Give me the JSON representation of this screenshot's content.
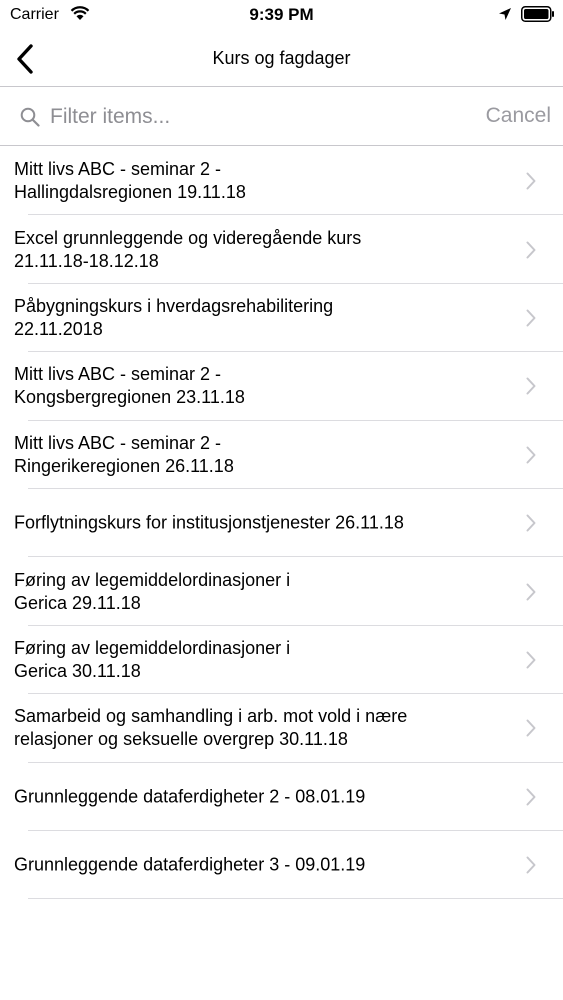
{
  "status_bar": {
    "carrier": "Carrier",
    "time": "9:39 PM"
  },
  "nav": {
    "title": "Kurs og fagdager"
  },
  "search": {
    "placeholder": "Filter items...",
    "cancel_label": "Cancel"
  },
  "items": [
    {
      "label": "Mitt livs ABC - seminar 2 -\nHallingdalsregionen 19.11.18"
    },
    {
      "label": "Excel grunnleggende og videregående kurs\n21.11.18-18.12.18"
    },
    {
      "label": "Påbygningskurs i hverdagsrehabilitering\n22.11.2018"
    },
    {
      "label": "Mitt livs ABC - seminar 2 -\nKongsbergregionen 23.11.18"
    },
    {
      "label": "Mitt livs ABC - seminar 2 -\nRingerikeregionen 26.11.18"
    },
    {
      "label": "Forflytningskurs for institusjonstjenester 26.11.18"
    },
    {
      "label": "Føring av legemiddelordinasjoner i\nGerica 29.11.18"
    },
    {
      "label": "Føring av legemiddelordinasjoner i\nGerica 30.11.18"
    },
    {
      "label": "Samarbeid og samhandling i arb. mot vold i nære\nrelasjoner og seksuelle overgrep 30.11.18"
    },
    {
      "label": "Grunnleggende dataferdigheter 2 -  08.01.19"
    },
    {
      "label": "Grunnleggende dataferdigheter 3 - 09.01.19"
    }
  ]
}
